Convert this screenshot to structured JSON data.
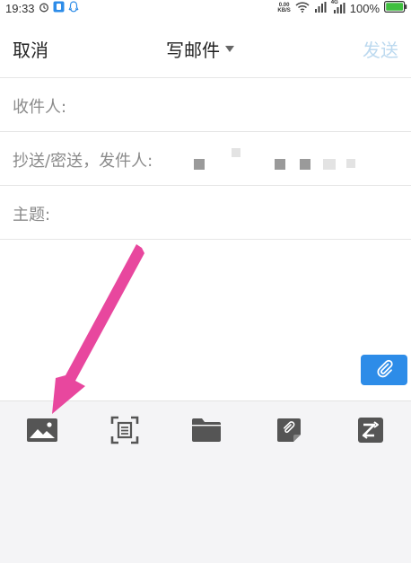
{
  "status_bar": {
    "time": "19:33",
    "net_speed_value": "0.00",
    "net_speed_unit": "KB/S",
    "network_type": "4G",
    "battery": "100%"
  },
  "nav": {
    "cancel_label": "取消",
    "title": "写邮件",
    "send_label": "发送"
  },
  "fields": {
    "to_label": "收件人:",
    "cc_label": "抄送/密送，发件人:",
    "subject_label": "主题:"
  },
  "colors": {
    "accent_blue": "#2d8ce8",
    "send_disabled": "#bcd9ef",
    "arrow": "#e8479e"
  },
  "toolbar": {
    "icons": [
      "image-icon",
      "scan-document-icon",
      "folder-icon",
      "note-attachment-icon",
      "translate-icon"
    ]
  }
}
